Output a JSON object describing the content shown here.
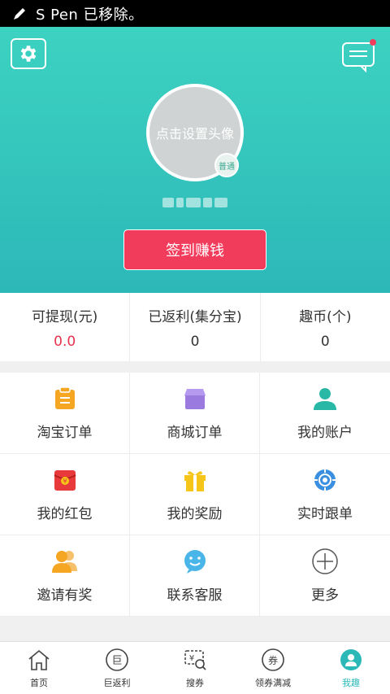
{
  "status_bar": {
    "message": "S Pen 已移除。"
  },
  "header": {
    "avatar_hint": "点击设置头像",
    "level_badge": "普通",
    "checkin_label": "签到赚钱"
  },
  "stats": [
    {
      "label": "可提现(元)",
      "value": "0.0"
    },
    {
      "label": "已返利(集分宝)",
      "value": "0"
    },
    {
      "label": "趣币(个)",
      "value": "0"
    }
  ],
  "grid": [
    {
      "label": "淘宝订单",
      "icon": "taobao-order-icon",
      "color": "#f5a623"
    },
    {
      "label": "商城订单",
      "icon": "mall-order-icon",
      "color": "#9b7ae0"
    },
    {
      "label": "我的账户",
      "icon": "account-icon",
      "color": "#2ab8a6"
    },
    {
      "label": "我的红包",
      "icon": "red-packet-icon",
      "color": "#e83a3a"
    },
    {
      "label": "我的奖励",
      "icon": "gift-icon",
      "color": "#f5c518"
    },
    {
      "label": "实时跟单",
      "icon": "tracking-icon",
      "color": "#3a8fe0"
    },
    {
      "label": "邀请有奖",
      "icon": "invite-icon",
      "color": "#f5a623"
    },
    {
      "label": "联系客服",
      "icon": "service-icon",
      "color": "#4ab5e8"
    },
    {
      "label": "更多",
      "icon": "more-icon",
      "color": "#555555"
    }
  ],
  "tabbar": [
    {
      "label": "首页",
      "icon": "home-icon"
    },
    {
      "label": "巨返利",
      "icon": "rebate-icon",
      "glyph": "巨"
    },
    {
      "label": "搜券",
      "icon": "search-coupon-icon",
      "glyph": "¥"
    },
    {
      "label": "领券满减",
      "icon": "coupon-icon",
      "glyph": "券"
    },
    {
      "label": "我趣",
      "icon": "profile-icon"
    }
  ],
  "colors": {
    "accent": "#2db8b8",
    "checkin": "#f23c5c",
    "value_red": "#e8334f"
  }
}
